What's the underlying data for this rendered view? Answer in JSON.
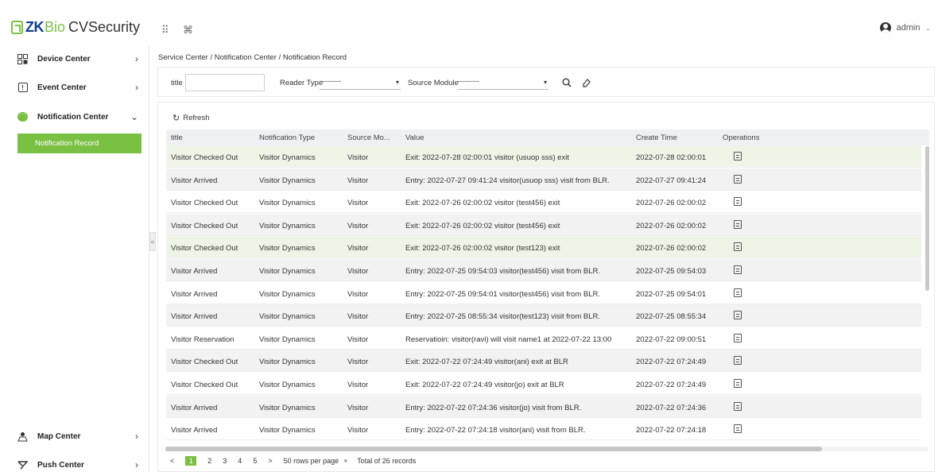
{
  "header": {
    "logo_zk": "ZK",
    "logo_bio": "Bio",
    "logo_rest": "CVSecurity",
    "apps_icon": "grid-icon",
    "shortcut_icon": "command-icon",
    "user": "admin",
    "user_caret": "⌄"
  },
  "sidebar": {
    "items": [
      {
        "label": "Device Center",
        "icon": "device-icon",
        "chevron": "›"
      },
      {
        "label": "Event Center",
        "icon": "event-icon",
        "chevron": "›"
      },
      {
        "label": "Notification Center",
        "icon": "chat-icon",
        "chevron": "⌄"
      },
      {
        "label": "Map Center",
        "icon": "map-icon",
        "chevron": "›"
      },
      {
        "label": "Push Center",
        "icon": "push-icon",
        "chevron": "›"
      }
    ],
    "sub_item": "Notification Record",
    "collapse": "«"
  },
  "breadcrumb": "Service Center / Notification Center / Notification Record",
  "filters": {
    "title_label": "title",
    "reader_label": "Reader Type",
    "reader_value": "---------",
    "source_label": "Source Module",
    "source_value": "---------",
    "caret": "▾",
    "search_icon": "search-icon",
    "clear_icon": "eraser-icon"
  },
  "toolbar": {
    "refresh": "Refresh"
  },
  "table": {
    "headers": [
      "title",
      "Notification Type",
      "Source Mo...",
      "Value",
      "Create Time",
      "Operations"
    ],
    "rows": [
      {
        "title": "Visitor Checked Out",
        "type": "Visitor Dynamics",
        "source": "Visitor",
        "value": "Exit: 2022-07-28 02:00:01 visitor (usuop sss) exit",
        "time": "2022-07-28 02:00:01"
      },
      {
        "title": "Visitor Arrived",
        "type": "Visitor Dynamics",
        "source": "Visitor",
        "value": "Entry: 2022-07-27 09:41:24 visitor(usuop sss) visit from BLR.",
        "time": "2022-07-27 09:41:24"
      },
      {
        "title": "Visitor Checked Out",
        "type": "Visitor Dynamics",
        "source": "Visitor",
        "value": "Exit: 2022-07-26 02:00:02 visitor (test456) exit",
        "time": "2022-07-26 02:00:02"
      },
      {
        "title": "Visitor Checked Out",
        "type": "Visitor Dynamics",
        "source": "Visitor",
        "value": "Exit: 2022-07-26 02:00:02 visitor (test456) exit",
        "time": "2022-07-26 02:00:02"
      },
      {
        "title": "Visitor Checked Out",
        "type": "Visitor Dynamics",
        "source": "Visitor",
        "value": "Exit: 2022-07-26 02:00:02 visitor (test123) exit",
        "time": "2022-07-26 02:00:02"
      },
      {
        "title": "Visitor Arrived",
        "type": "Visitor Dynamics",
        "source": "Visitor",
        "value": "Entry: 2022-07-25 09:54:03 visitor(test456) visit from BLR.",
        "time": "2022-07-25 09:54:03"
      },
      {
        "title": "Visitor Arrived",
        "type": "Visitor Dynamics",
        "source": "Visitor",
        "value": "Entry: 2022-07-25 09:54:01 visitor(test456) visit from BLR.",
        "time": "2022-07-25 09:54:01"
      },
      {
        "title": "Visitor Arrived",
        "type": "Visitor Dynamics",
        "source": "Visitor",
        "value": "Entry: 2022-07-25 08:55:34 visitor(test123) visit from BLR.",
        "time": "2022-07-25 08:55:34"
      },
      {
        "title": "Visitor Reservation",
        "type": "Visitor Dynamics",
        "source": "Visitor",
        "value": "Reservatioin: visitor(ravi) will visit name1 at 2022-07-22 13:00",
        "time": "2022-07-22 09:00:51"
      },
      {
        "title": "Visitor Checked Out",
        "type": "Visitor Dynamics",
        "source": "Visitor",
        "value": "Exit: 2022-07-22 07:24:49 visitor(ani) exit at BLR",
        "time": "2022-07-22 07:24:49"
      },
      {
        "title": "Visitor Checked Out",
        "type": "Visitor Dynamics",
        "source": "Visitor",
        "value": "Exit: 2022-07-22 07:24:49 visitor(jo) exit at BLR",
        "time": "2022-07-22 07:24:49"
      },
      {
        "title": "Visitor Arrived",
        "type": "Visitor Dynamics",
        "source": "Visitor",
        "value": "Entry: 2022-07-22 07:24:36 visitor(jo) visit from BLR.",
        "time": "2022-07-22 07:24:36"
      },
      {
        "title": "Visitor Arrived",
        "type": "Visitor Dynamics",
        "source": "Visitor",
        "value": "Entry: 2022-07-22 07:24:18 visitor(ani) visit from BLR.",
        "time": "2022-07-22 07:24:18"
      }
    ]
  },
  "pager": {
    "prev": "<",
    "pages": [
      "1",
      "2",
      "3",
      "4",
      "5"
    ],
    "next": ">",
    "per_page": "50 rows per page",
    "per_caret": "▾",
    "total": "Total of 26 records"
  },
  "colors": {
    "accent": "#7ac143",
    "brand": "#0b3d91"
  }
}
